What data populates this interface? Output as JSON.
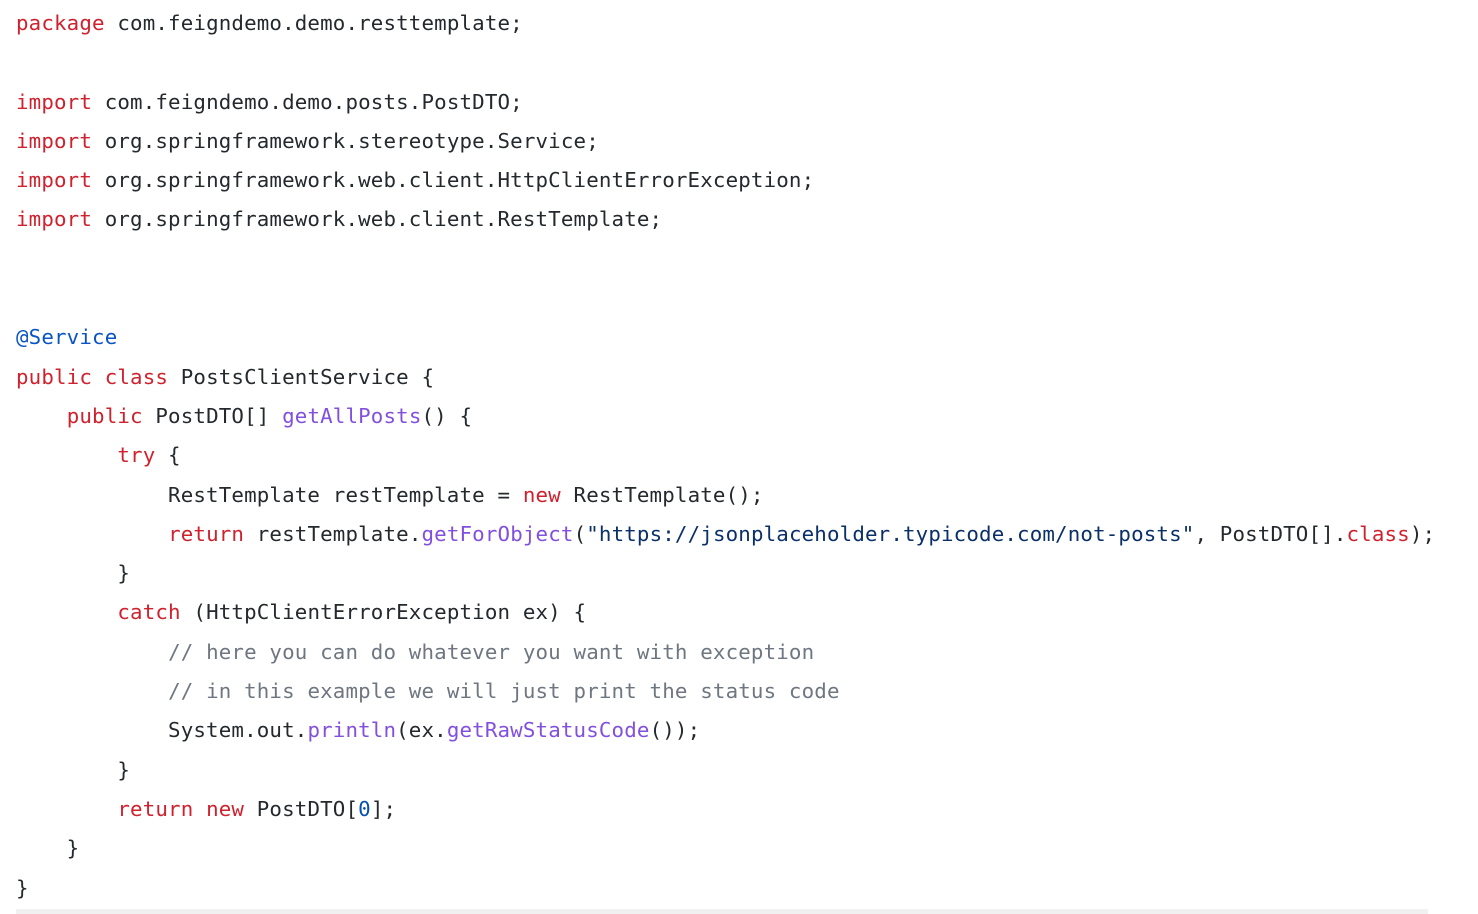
{
  "code": {
    "language": "java",
    "lines": [
      [
        {
          "t": "package",
          "k": "keyword"
        },
        {
          "t": " com.feigndemo.demo.resttemplate;",
          "k": "plain"
        }
      ],
      [],
      [
        {
          "t": "import",
          "k": "keyword"
        },
        {
          "t": " com.feigndemo.demo.posts.PostDTO;",
          "k": "plain"
        }
      ],
      [
        {
          "t": "import",
          "k": "keyword"
        },
        {
          "t": " org.springframework.stereotype.Service;",
          "k": "plain"
        }
      ],
      [
        {
          "t": "import",
          "k": "keyword"
        },
        {
          "t": " org.springframework.web.client.HttpClientErrorException;",
          "k": "plain"
        }
      ],
      [
        {
          "t": "import",
          "k": "keyword"
        },
        {
          "t": " org.springframework.web.client.RestTemplate;",
          "k": "plain"
        }
      ],
      [],
      [],
      [
        {
          "t": "@Service",
          "k": "annotation"
        }
      ],
      [
        {
          "t": "public",
          "k": "keyword"
        },
        {
          "t": " ",
          "k": "plain"
        },
        {
          "t": "class",
          "k": "keyword"
        },
        {
          "t": " PostsClientService {",
          "k": "plain"
        }
      ],
      [
        {
          "t": "    ",
          "k": "plain"
        },
        {
          "t": "public",
          "k": "keyword"
        },
        {
          "t": " PostDTO[] ",
          "k": "plain"
        },
        {
          "t": "getAllPosts",
          "k": "function"
        },
        {
          "t": "() {",
          "k": "plain"
        }
      ],
      [
        {
          "t": "        ",
          "k": "plain"
        },
        {
          "t": "try",
          "k": "keyword"
        },
        {
          "t": " {",
          "k": "plain"
        }
      ],
      [
        {
          "t": "            RestTemplate restTemplate = ",
          "k": "plain"
        },
        {
          "t": "new",
          "k": "keyword"
        },
        {
          "t": " RestTemplate();",
          "k": "plain"
        }
      ],
      [
        {
          "t": "            ",
          "k": "plain"
        },
        {
          "t": "return",
          "k": "keyword"
        },
        {
          "t": " restTemplate.",
          "k": "plain"
        },
        {
          "t": "getForObject",
          "k": "function"
        },
        {
          "t": "(",
          "k": "plain"
        },
        {
          "t": "\"https://jsonplaceholder.typicode.com/not-posts\"",
          "k": "string"
        },
        {
          "t": ", PostDTO[].",
          "k": "plain"
        },
        {
          "t": "class",
          "k": "keyword"
        },
        {
          "t": ");",
          "k": "plain"
        }
      ],
      [
        {
          "t": "        }",
          "k": "plain"
        }
      ],
      [
        {
          "t": "        ",
          "k": "plain"
        },
        {
          "t": "catch",
          "k": "keyword"
        },
        {
          "t": " (HttpClientErrorException ex) {",
          "k": "plain"
        }
      ],
      [
        {
          "t": "            ",
          "k": "plain"
        },
        {
          "t": "// here you can do whatever you want with exception",
          "k": "comment"
        }
      ],
      [
        {
          "t": "            ",
          "k": "plain"
        },
        {
          "t": "// in this example we will just print the status code",
          "k": "comment"
        }
      ],
      [
        {
          "t": "            System.out.",
          "k": "plain"
        },
        {
          "t": "println",
          "k": "function"
        },
        {
          "t": "(ex.",
          "k": "plain"
        },
        {
          "t": "getRawStatusCode",
          "k": "function"
        },
        {
          "t": "());",
          "k": "plain"
        }
      ],
      [
        {
          "t": "        }",
          "k": "plain"
        }
      ],
      [
        {
          "t": "        ",
          "k": "plain"
        },
        {
          "t": "return",
          "k": "keyword"
        },
        {
          "t": " ",
          "k": "plain"
        },
        {
          "t": "new",
          "k": "keyword"
        },
        {
          "t": " PostDTO[",
          "k": "plain"
        },
        {
          "t": "0",
          "k": "number"
        },
        {
          "t": "];",
          "k": "plain"
        }
      ],
      [
        {
          "t": "    }",
          "k": "plain"
        }
      ],
      [
        {
          "t": "}",
          "k": "plain"
        }
      ]
    ]
  },
  "colors": {
    "keyword": "#cf222e",
    "function": "#8250df",
    "annotation": "#0a54c4",
    "string": "#0a3069",
    "number": "#0550ae",
    "comment": "#6e7781",
    "plain": "#24292e",
    "background": "#ffffff"
  }
}
